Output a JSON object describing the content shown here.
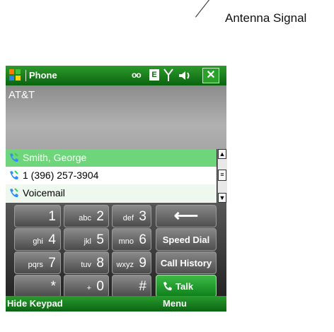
{
  "annotation": {
    "label": "Antenna Signal"
  },
  "titlebar": {
    "app_title": "Phone",
    "network_letter": "E",
    "close_glyph": "✕",
    "voicemail_glyph": "ᴏᴏ"
  },
  "carrier": {
    "name": "AT&T"
  },
  "list": {
    "items": [
      {
        "label": "Smith, George"
      },
      {
        "label": "1 (396) 257-3904"
      },
      {
        "label": "Voicemail"
      }
    ]
  },
  "scrollbar": {
    "up": "▲",
    "thumb": "≡",
    "down": "▼"
  },
  "keypad": {
    "keys": [
      {
        "sub": "",
        "main": "1"
      },
      {
        "sub": "abc",
        "main": "2"
      },
      {
        "sub": "def",
        "main": "3"
      },
      {
        "sub": "ghi",
        "main": "4"
      },
      {
        "sub": "jkl",
        "main": "5"
      },
      {
        "sub": "mno",
        "main": "6"
      },
      {
        "sub": "pqrs",
        "main": "7"
      },
      {
        "sub": "tuv",
        "main": "8"
      },
      {
        "sub": "wxyz",
        "main": "9"
      },
      {
        "sub": "",
        "main": "*"
      },
      {
        "sub": "+",
        "main": "0"
      },
      {
        "sub": "",
        "main": "#"
      }
    ],
    "backspace_glyph": "⟵",
    "speed_dial": "Speed Dial",
    "call_history": "Call History",
    "talk": "Talk"
  },
  "softkeys": {
    "left": "Hide Keypad",
    "right": "Menu"
  },
  "colors": {
    "accent_green": "#0b6410",
    "selected_row": "#6ed67a"
  }
}
